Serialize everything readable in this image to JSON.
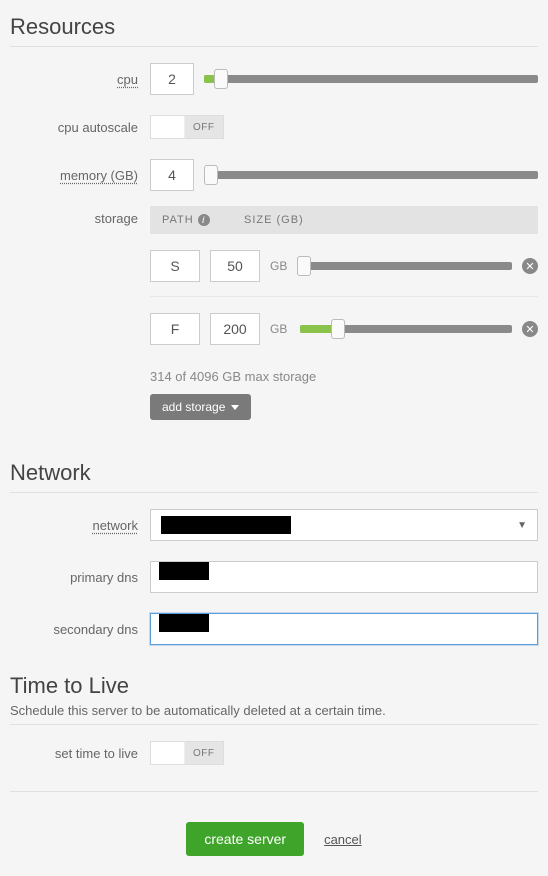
{
  "sections": {
    "resources": "Resources",
    "network": "Network",
    "ttl": "Time to Live"
  },
  "ttl_desc": "Schedule this server to be automatically deleted at a certain time.",
  "labels": {
    "cpu": "cpu",
    "cpu_autoscale": "cpu autoscale",
    "memory": "memory (GB)",
    "storage": "storage",
    "network": "network",
    "primary_dns": "primary dns",
    "secondary_dns": "secondary dns",
    "set_ttl": "set time to live"
  },
  "cpu": {
    "value": "2",
    "fill_pct": 5,
    "thumb_pct": 5
  },
  "cpu_autoscale": {
    "state": "OFF"
  },
  "memory": {
    "value": "4",
    "fill_pct": 0,
    "thumb_pct": 2
  },
  "storage": {
    "header_path": "PATH",
    "header_size": "SIZE (GB)",
    "unit": "GB",
    "rows": [
      {
        "path": "S",
        "size": "50",
        "fill_pct": 0,
        "thumb_pct": 2
      },
      {
        "path": "F",
        "size": "200",
        "fill_pct": 18,
        "thumb_pct": 18
      }
    ],
    "note": "314 of 4096 GB max storage",
    "add_label": "add storage"
  },
  "network": {
    "selected": "",
    "primary_dns": "",
    "secondary_dns": ""
  },
  "ttl": {
    "state": "OFF"
  },
  "actions": {
    "create": "create server",
    "cancel": "cancel"
  }
}
